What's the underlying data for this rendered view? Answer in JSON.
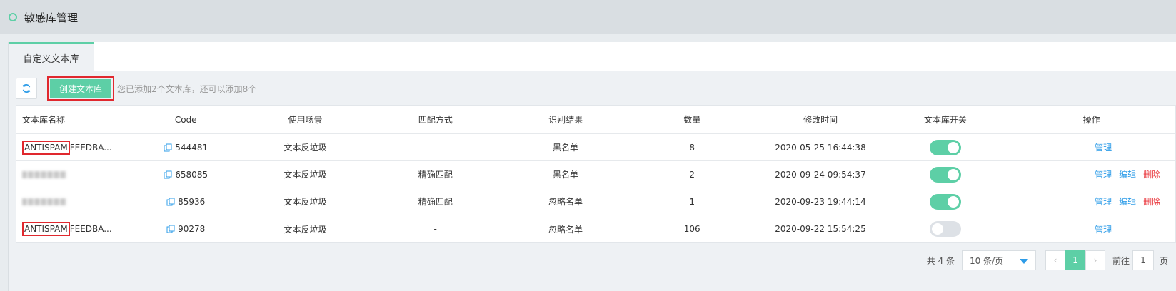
{
  "header": {
    "title": "敏感库管理"
  },
  "tabs": [
    {
      "label": "自定义文本库"
    }
  ],
  "toolbar": {
    "create_label": "创建文本库",
    "hint": "您已添加2个文本库，还可以添加8个"
  },
  "table": {
    "columns": [
      "文本库名称",
      "Code",
      "使用场景",
      "匹配方式",
      "识别结果",
      "数量",
      "修改时间",
      "文本库开关",
      "操作"
    ],
    "rows": [
      {
        "name_tag": "ANTISPAM",
        "name_rest": "FEEDBA...",
        "code": "544481",
        "scene": "文本反垃圾",
        "match": "-",
        "result": "黑名单",
        "count": "8",
        "time": "2020-05-25 16:44:38",
        "enabled": true,
        "actions": [
          "管理"
        ]
      },
      {
        "name_blurred": true,
        "code": "658085",
        "scene": "文本反垃圾",
        "match": "精确匹配",
        "result": "黑名单",
        "count": "2",
        "time": "2020-09-24 09:54:37",
        "enabled": true,
        "actions": [
          "管理",
          "编辑",
          "删除"
        ]
      },
      {
        "name_blurred": true,
        "code": "85936",
        "scene": "文本反垃圾",
        "match": "精确匹配",
        "result": "忽略名单",
        "count": "1",
        "time": "2020-09-23 19:44:14",
        "enabled": true,
        "actions": [
          "管理",
          "编辑",
          "删除"
        ]
      },
      {
        "name_tag": "ANTISPAM",
        "name_rest": "FEEDBA...",
        "code": "90278",
        "scene": "文本反垃圾",
        "match": "-",
        "result": "忽略名单",
        "count": "106",
        "time": "2020-09-22 15:54:25",
        "enabled": false,
        "actions": [
          "管理"
        ]
      }
    ]
  },
  "pager": {
    "total": "共 4 条",
    "page_size": "10 条/页",
    "current": "1",
    "goto_label": "前往",
    "goto_value": "1",
    "goto_unit": "页"
  },
  "colors": {
    "accent": "#5dcfa6",
    "link": "#2d9ce8",
    "danger": "#e9343a",
    "highlight": "#e0282e"
  }
}
